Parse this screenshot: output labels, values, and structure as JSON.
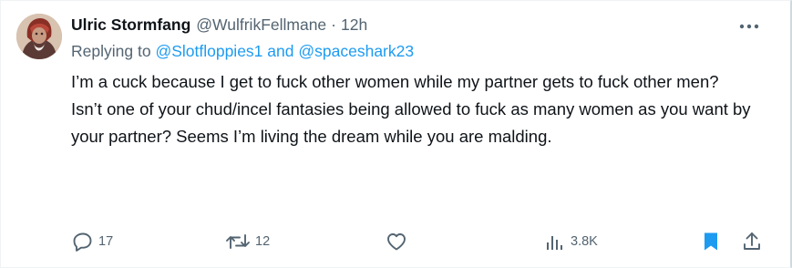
{
  "tweet": {
    "display_name": "Ulric Stormfang",
    "handle": "@WulfrikFellmane",
    "separator": "·",
    "timestamp": "12h",
    "replying_prefix": "Replying to",
    "replying_to": [
      "@Slotfloppies1",
      "@spaceshark23"
    ],
    "replying_conjunction": "and",
    "text_paragraphs": [
      "I’m a cuck because I get to fuck other women while my partner gets to fuck other men?",
      "Isn’t one of your chud/incel fantasies being allowed to fuck as many women as you want by your partner? Seems I’m living the dream while you are malding."
    ]
  },
  "actions": {
    "reply_count": "17",
    "retweet_count": "12",
    "like_count": "",
    "views_count": "3.8K"
  },
  "colors": {
    "text": "#0f1419",
    "secondary": "#536471",
    "link": "#1d9bf0",
    "bookmark_active": "#1d9bf0"
  },
  "icons": {
    "more": "more-dots-icon",
    "reply": "speech-bubble-icon",
    "retweet": "retweet-arrows-icon",
    "like": "heart-icon",
    "views": "bar-chart-icon",
    "bookmark": "bookmark-icon",
    "share": "share-upload-icon"
  }
}
